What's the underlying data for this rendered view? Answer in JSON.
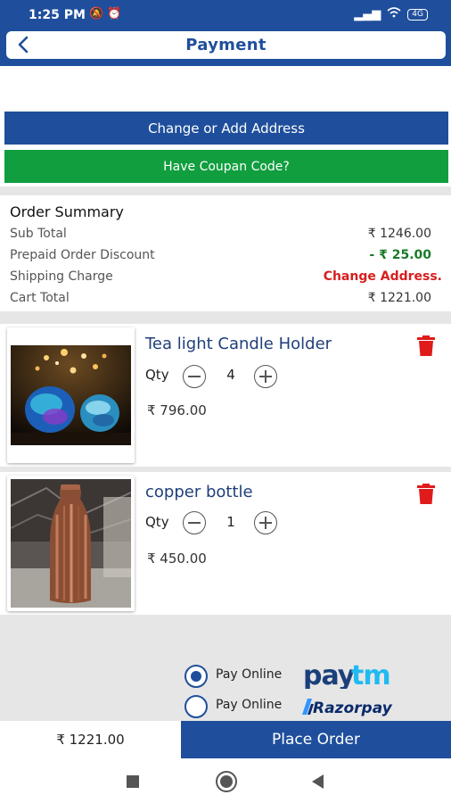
{
  "status_bar": {
    "time": "1:25 PM",
    "network": "4G"
  },
  "header": {
    "title": "Payment"
  },
  "actions": {
    "change_address": "Change or Add Address",
    "coupon": "Have Coupan Code?"
  },
  "order_summary": {
    "title": "Order Summary",
    "rows": [
      {
        "label": "Sub Total",
        "value": "₹ 1246.00"
      },
      {
        "label": "Prepaid Order Discount",
        "value": "- ₹ 25.00"
      },
      {
        "label": "Shipping Charge",
        "value": "Change Address."
      },
      {
        "label": "Cart Total",
        "value": "₹ 1221.00"
      }
    ]
  },
  "cart": {
    "qty_label": "Qty",
    "items": [
      {
        "name": "Tea light Candle Holder",
        "qty": "4",
        "price": "₹ 796.00"
      },
      {
        "name": "copper bottle",
        "qty": "1",
        "price": "₹ 450.00"
      }
    ]
  },
  "payment": {
    "options": [
      {
        "label": "Pay Online",
        "provider": "Paytm",
        "brand_text": "paytm",
        "selected": true
      },
      {
        "label": "Pay Online",
        "provider": "Razorpay",
        "brand_text": "Razorpay",
        "selected": false
      }
    ]
  },
  "footer": {
    "total": "₹ 1221.00",
    "place_order": "Place Order"
  },
  "colors": {
    "primary": "#1f4f9c",
    "green": "#109e3e",
    "discount": "#1a7a2a",
    "warning": "#d81e1e",
    "paytm_sky": "#20baf0",
    "razorpay_navy": "#0a2b6b"
  }
}
